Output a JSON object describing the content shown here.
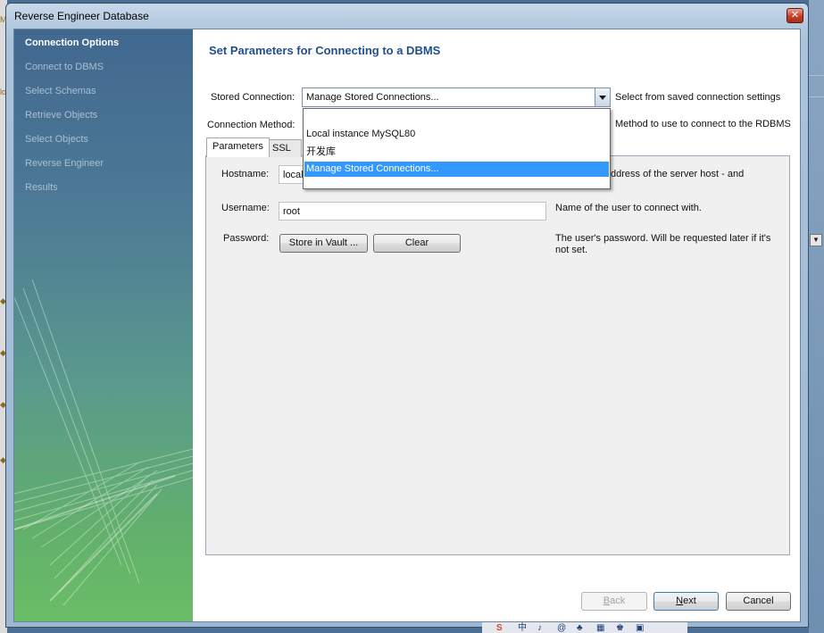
{
  "window": {
    "title": "Reverse Engineer Database",
    "close_glyph": "✕"
  },
  "sidebar": {
    "steps": [
      {
        "label": "Connection Options",
        "active": true
      },
      {
        "label": "Connect to DBMS",
        "active": false
      },
      {
        "label": "Select Schemas",
        "active": false
      },
      {
        "label": "Retrieve Objects",
        "active": false
      },
      {
        "label": "Select Objects",
        "active": false
      },
      {
        "label": "Reverse Engineer",
        "active": false
      },
      {
        "label": "Results",
        "active": false
      }
    ]
  },
  "main": {
    "title": "Set Parameters for Connecting to a DBMS",
    "stored_connection": {
      "label": "Stored Connection:",
      "value": "Manage Stored Connections...",
      "hint": "Select from saved connection settings"
    },
    "connection_method": {
      "label": "Connection Method:",
      "hint": "Method to use to connect to the RDBMS"
    },
    "dropdown_items": [
      {
        "label": "",
        "selected": false
      },
      {
        "label": "Local instance MySQL80",
        "selected": false
      },
      {
        "label": "开发库",
        "selected": false
      },
      {
        "label": "Manage Stored Connections...",
        "selected": true
      }
    ],
    "tabs": [
      {
        "label": "Parameters",
        "active": true
      },
      {
        "label": "SSL",
        "active": false
      }
    ],
    "hostname": {
      "label": "Hostname:",
      "value": "locall",
      "hint": "ddress of the server host - and"
    },
    "username": {
      "label": "Username:",
      "value": "root",
      "hint": "Name of the user to connect with."
    },
    "password": {
      "label": "Password:",
      "store_button": "Store in Vault ...",
      "clear_button": "Clear",
      "hint": "The user's password. Will be requested later if it's not set."
    }
  },
  "footer": {
    "back_label": "Back",
    "back_underline": "B",
    "back_rest": "ack",
    "next_label": "Next",
    "next_underline": "N",
    "next_rest": "ext",
    "cancel_label": "Cancel"
  },
  "background": {
    "tray_icons": [
      "S",
      "中",
      "♪",
      "@",
      "♣",
      "▦",
      "♚",
      "▣"
    ]
  }
}
